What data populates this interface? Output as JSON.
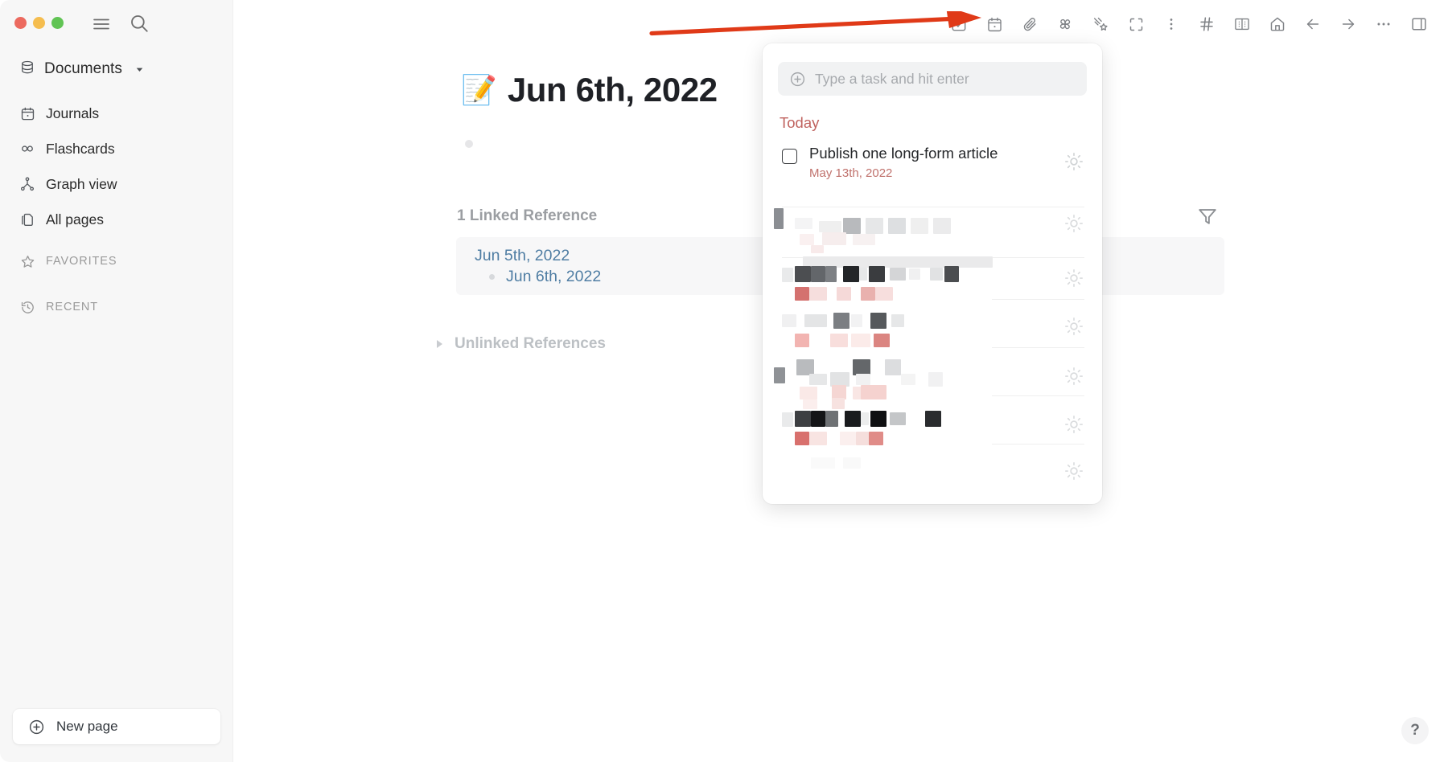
{
  "window": {
    "traffic_lights": [
      "close",
      "minimize",
      "zoom"
    ],
    "colors": {
      "close": "#ec6a5f",
      "minimize": "#f5bd4f",
      "zoom": "#61c454",
      "accent_red": "#c0635f",
      "link_blue": "#4f7da3",
      "annotation_arrow": "#e03a18",
      "sidebar_bg": "#f7f7f7"
    }
  },
  "sidebar": {
    "hamburger_icon": "hamburger-icon",
    "search_icon": "search-icon",
    "workspace": {
      "label": "Documents",
      "icon": "database-icon",
      "chevron": "chevron-down-icon"
    },
    "items": [
      {
        "label": "Journals",
        "icon": "calendar-icon"
      },
      {
        "label": "Flashcards",
        "icon": "infinity-icon"
      },
      {
        "label": "Graph view",
        "icon": "graph-icon"
      },
      {
        "label": "All pages",
        "icon": "pages-icon"
      }
    ],
    "sections": [
      {
        "label": "FAVORITES",
        "icon": "star-icon"
      },
      {
        "label": "RECENT",
        "icon": "clock-icon"
      }
    ],
    "new_page": {
      "label": "New page",
      "icon": "plus-circle-icon"
    }
  },
  "toolbar": {
    "buttons": [
      {
        "name": "todo-check-icon",
        "tooltip": "Todo"
      },
      {
        "name": "calendar-icon",
        "tooltip": "Calendar"
      },
      {
        "name": "paperclip-icon",
        "tooltip": "Attach"
      },
      {
        "name": "pinwheel-icon",
        "tooltip": "Plugins"
      },
      {
        "name": "shooting-star-icon",
        "tooltip": "Magic"
      },
      {
        "name": "fullscreen-icon",
        "tooltip": "Full screen"
      },
      {
        "name": "kebab-menu-icon",
        "tooltip": "More"
      },
      {
        "name": "hash-icon",
        "tooltip": "Tags"
      },
      {
        "name": "book-icon",
        "tooltip": "Flashcards"
      },
      {
        "name": "home-icon",
        "tooltip": "Home"
      },
      {
        "name": "arrow-left-icon",
        "tooltip": "Back"
      },
      {
        "name": "arrow-right-icon",
        "tooltip": "Forward"
      },
      {
        "name": "ellipsis-icon",
        "tooltip": "More options"
      },
      {
        "name": "right-sidebar-icon",
        "tooltip": "Toggle right sidebar"
      }
    ]
  },
  "annotation": {
    "type": "arrow",
    "points_to": "todo-check-icon",
    "color": "#e03a18"
  },
  "main": {
    "page_emoji": "📝",
    "page_title": "Jun 6th, 2022",
    "linked_references_heading": "1 Linked Reference",
    "filter_icon": "filter-icon",
    "reference": {
      "parent_page": "Jun 5th, 2022",
      "child_block": "Jun 6th, 2022"
    },
    "unlinked_references_heading": "Unlinked References",
    "unlinked_collapsed": true
  },
  "task_panel": {
    "input_placeholder": "Type a task and hit enter",
    "input_value": "",
    "add_icon": "plus-circle-icon",
    "group_label": "Today",
    "tasks": [
      {
        "text": "Publish one long-form article",
        "date": "May 13th, 2022",
        "checked": false,
        "action_icon": "sun-icon"
      },
      {
        "text": "",
        "date": "",
        "checked": false,
        "redacted": true,
        "action_icon": "sun-icon"
      },
      {
        "text": "",
        "date": "",
        "checked": false,
        "redacted": true,
        "action_icon": "sun-icon"
      },
      {
        "text": "",
        "date": "",
        "checked": false,
        "redacted": true,
        "action_icon": "sun-icon"
      },
      {
        "text": "",
        "date": "",
        "checked": false,
        "redacted": true,
        "action_icon": "sun-icon"
      },
      {
        "text": "",
        "date": "",
        "checked": false,
        "redacted": true,
        "action_icon": "sun-icon"
      },
      {
        "text": "",
        "date": "",
        "checked": false,
        "redacted": true,
        "action_icon": "sun-icon"
      }
    ]
  },
  "help": {
    "label": "?",
    "icon": "question-mark-icon"
  }
}
